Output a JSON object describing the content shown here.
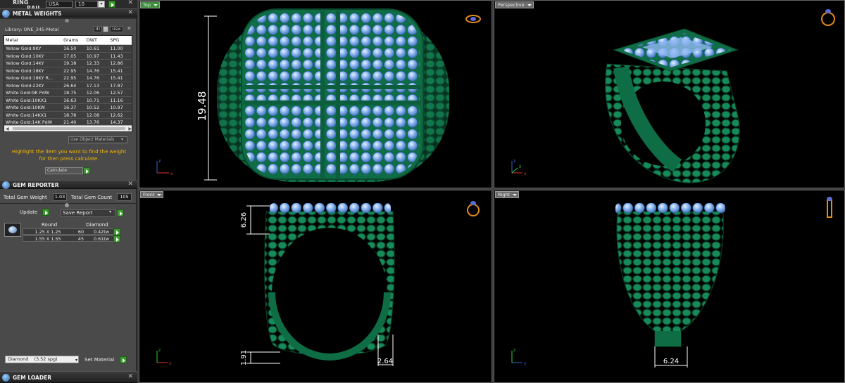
{
  "header": {
    "app_title_line1": "RING",
    "app_title_line2": "RAIL",
    "country": "USA",
    "size_value": "10"
  },
  "metal_weights": {
    "title": "METAL WEIGHTS",
    "library": "Library: ONE_245-Metal",
    "unit_options": [
      "dz",
      "Usw"
    ],
    "columns": [
      "Metal",
      "Grams",
      "DWT",
      "SPG"
    ],
    "rows": [
      [
        "Yellow Gold:9KY",
        "16.50",
        "10.61",
        "11.00"
      ],
      [
        "Yellow Gold:10KY",
        "17.05",
        "10.97",
        "11.43"
      ],
      [
        "Yellow Gold:14KY",
        "19.18",
        "12.33",
        "12.86"
      ],
      [
        "Yellow Gold:18KY",
        "22.95",
        "14.76",
        "15.41"
      ],
      [
        "Yellow Gold:18KY R...",
        "22.95",
        "14.76",
        "15.41"
      ],
      [
        "Yellow Gold:22KY",
        "26.64",
        "17.13",
        "17.87"
      ],
      [
        "White Gold:9K PdW",
        "18.75",
        "12.06",
        "12.57"
      ],
      [
        "White Gold:10KX1",
        "16.63",
        "10.71",
        "11.16"
      ],
      [
        "White Gold:10KW",
        "16.37",
        "10.52",
        "10.97"
      ],
      [
        "White Gold:14KX1",
        "18.78",
        "12.08",
        "12.62"
      ],
      [
        "White Gold:14K PdW",
        "21.40",
        "13.76",
        "14.37"
      ]
    ],
    "use_object_materials": "Use Object Materials",
    "hint_line1": "Highlight the item you want to find the weight",
    "hint_line2": "for then press calculate.",
    "calculate_label": "Calculate"
  },
  "gem_reporter": {
    "title": "GEM REPORTER",
    "total_weight_label": "Total Gem Weight",
    "total_weight_value": "1.03",
    "total_count_label": "Total Gem Count",
    "total_count_value": "105",
    "update_label": "Update",
    "save_report_label": "Save Report",
    "col_round": "Round",
    "col_diamond": "Diamond",
    "rows": [
      [
        "1.25 X 1.25",
        "60",
        "0.42tw"
      ],
      [
        "1.55 X 1.55",
        "45",
        "0.61tw"
      ]
    ]
  },
  "bottom": {
    "material_select": "Diamond",
    "material_spg": "(3.52 spg)",
    "set_material_label": "Set Material",
    "gem_loader_title": "GEM LOADER"
  },
  "viewports": {
    "top": {
      "label": "Top",
      "dimension": "19.48"
    },
    "perspective": {
      "label": "Perspective"
    },
    "front": {
      "label": "Front",
      "dim_top": "6.26",
      "dim_bottom": "1.91",
      "dim_width": "2.64"
    },
    "right": {
      "label": "Right",
      "dim_width": "6.24"
    }
  },
  "axis_labels": {
    "x": "x",
    "y": "y",
    "z": "z"
  },
  "colors": {
    "ring_green": "#127a4e",
    "gem_blue": "#8fb8f0",
    "viewport_bg": "#000000",
    "hint_text": "#f5b800",
    "dimension_line": "#ffffff"
  }
}
